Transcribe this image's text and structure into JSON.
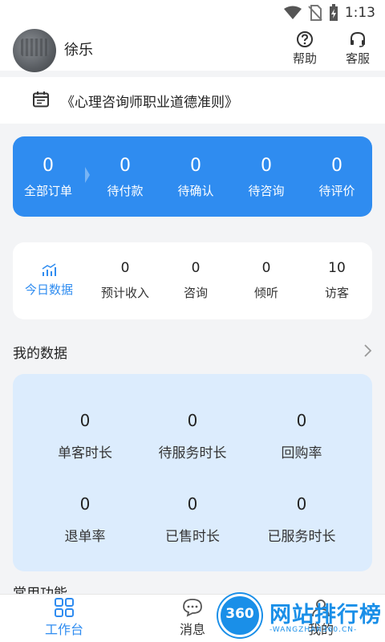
{
  "status_bar": {
    "time": "1:13"
  },
  "header": {
    "username": "徐乐",
    "help_label": "帮助",
    "service_label": "客服"
  },
  "notice": {
    "text": "《心理咨询师职业道德准则》"
  },
  "orders": [
    {
      "count": "0",
      "label": "全部订单"
    },
    {
      "count": "0",
      "label": "待付款"
    },
    {
      "count": "0",
      "label": "待确认"
    },
    {
      "count": "0",
      "label": "待咨询"
    },
    {
      "count": "0",
      "label": "待评价"
    }
  ],
  "today": {
    "tab_label": "今日数据",
    "items": [
      {
        "value": "0",
        "label": "预计收入"
      },
      {
        "value": "0",
        "label": "咨询"
      },
      {
        "value": "0",
        "label": "倾听"
      },
      {
        "value": "10",
        "label": "访客"
      }
    ]
  },
  "my_data": {
    "title": "我的数据",
    "items": [
      {
        "value": "0",
        "label": "单客时长"
      },
      {
        "value": "0",
        "label": "待服务时长"
      },
      {
        "value": "0",
        "label": "回购率"
      },
      {
        "value": "0",
        "label": "退单率"
      },
      {
        "value": "0",
        "label": "已售时长"
      },
      {
        "value": "0",
        "label": "已服务时长"
      }
    ]
  },
  "common_functions": {
    "title": "常用功能"
  },
  "tabbar": {
    "work_label": "工作台",
    "message_label": "消息",
    "mine_label": "我的"
  },
  "watermark": {
    "badge": "360",
    "title": "网站排行榜",
    "url": "-WANGZHAN360.CN-"
  },
  "colors": {
    "accent": "#2f8cf0",
    "data_panel": "#dcecfd"
  }
}
